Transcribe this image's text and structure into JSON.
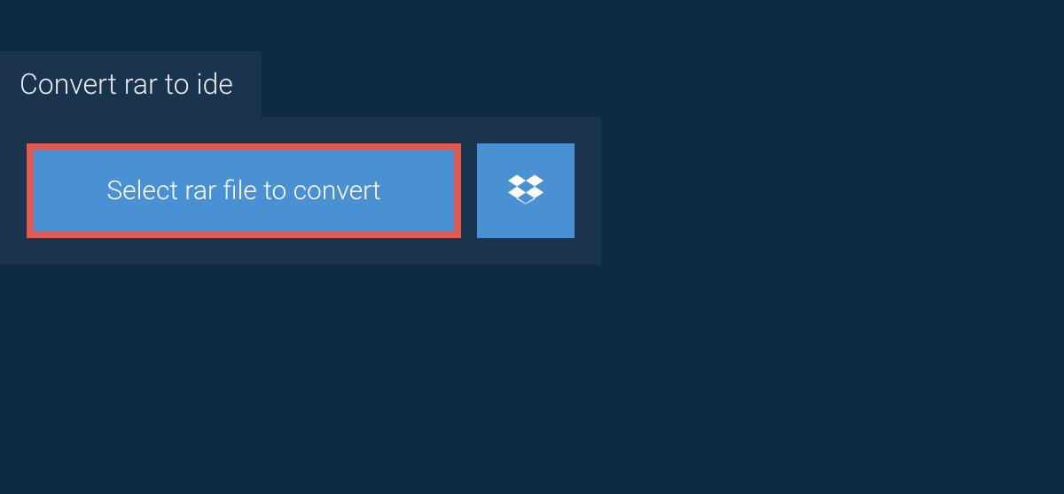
{
  "tab": {
    "title": "Convert rar to ide"
  },
  "panel": {
    "select_button_label": "Select rar file to convert",
    "dropbox_icon": "dropbox-icon"
  },
  "colors": {
    "background": "#0f2a43",
    "panel": "#1a344d",
    "button": "#4a91d4",
    "highlight_border": "#e05a4f",
    "text": "#ffffff"
  }
}
